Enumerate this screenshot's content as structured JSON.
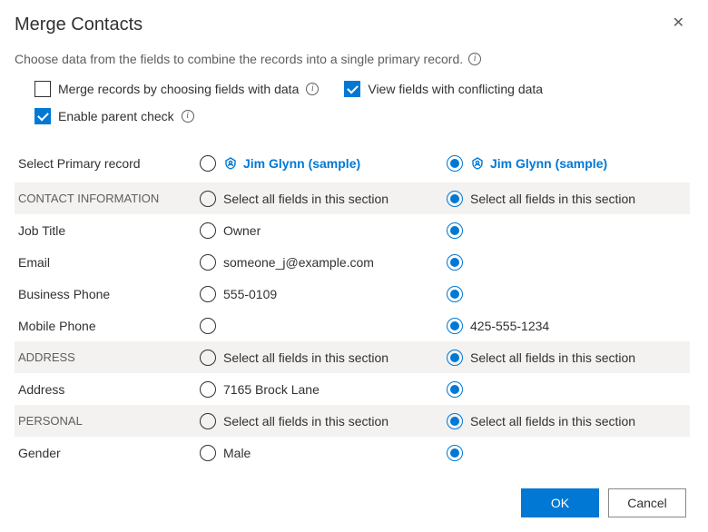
{
  "dialog": {
    "title": "Merge Contacts",
    "subtitle": "Choose data from the fields to combine the records into a single primary record.",
    "options": {
      "merge_by_fields_label": "Merge records by choosing fields with data",
      "merge_by_fields_checked": false,
      "view_conflicting_label": "View fields with conflicting data",
      "view_conflicting_checked": true,
      "enable_parent_label": "Enable parent check",
      "enable_parent_checked": true
    },
    "primary_label": "Select Primary record",
    "record_a": "Jim Glynn (sample)",
    "record_b": "Jim Glynn (sample)",
    "select_all_label": "Select all fields in this section",
    "sections": {
      "contact_info": "CONTACT INFORMATION",
      "address": "ADDRESS",
      "personal": "PERSONAL"
    },
    "fields": {
      "job_title": {
        "label": "Job Title",
        "a": "Owner",
        "b": ""
      },
      "email": {
        "label": "Email",
        "a": "someone_j@example.com",
        "b": ""
      },
      "business_phone": {
        "label": "Business Phone",
        "a": "555-0109",
        "b": ""
      },
      "mobile_phone": {
        "label": "Mobile Phone",
        "a": "",
        "b": "425-555-1234"
      },
      "address": {
        "label": "Address",
        "a": "7165 Brock Lane",
        "b": ""
      },
      "gender": {
        "label": "Gender",
        "a": "Male",
        "b": ""
      }
    },
    "footer": {
      "ok": "OK",
      "cancel": "Cancel"
    }
  }
}
